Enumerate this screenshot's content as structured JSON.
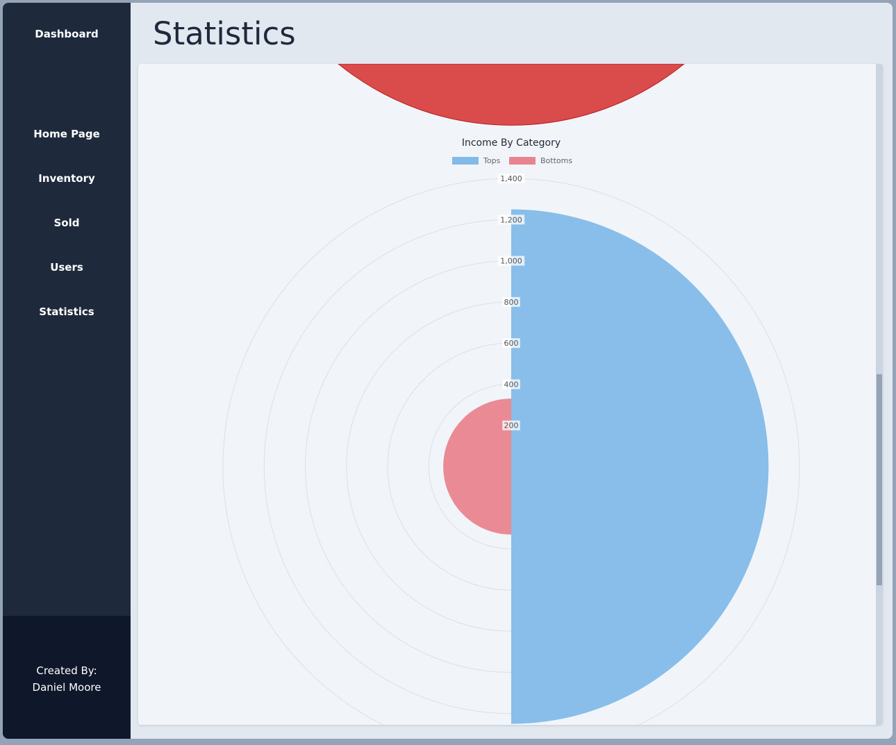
{
  "sidebar": {
    "brand": "Dashboard",
    "items": [
      {
        "label": "Home Page"
      },
      {
        "label": "Inventory"
      },
      {
        "label": "Sold"
      },
      {
        "label": "Users"
      },
      {
        "label": "Statistics"
      }
    ],
    "footer": {
      "line1": "Created By:",
      "line2": "Daniel Moore"
    }
  },
  "header": {
    "title": "Statistics"
  },
  "colors": {
    "sidebar": "#1e293b",
    "footer": "#0f172a",
    "tops": "#82bae8",
    "bottoms": "#e8848f",
    "prev_chart_red": "#da4b4b"
  },
  "chart_data": {
    "type": "polarArea",
    "title": "Income By Category",
    "categories": [
      "Tops",
      "Bottoms"
    ],
    "values": [
      1250,
      330
    ],
    "ticks": [
      200,
      400,
      600,
      800,
      1000,
      1200,
      1400
    ],
    "tick_labels": [
      "200",
      "400",
      "600",
      "800",
      "1,000",
      "1,200",
      "1,400"
    ],
    "rmax": 1400,
    "legend": "top",
    "grid": true
  }
}
